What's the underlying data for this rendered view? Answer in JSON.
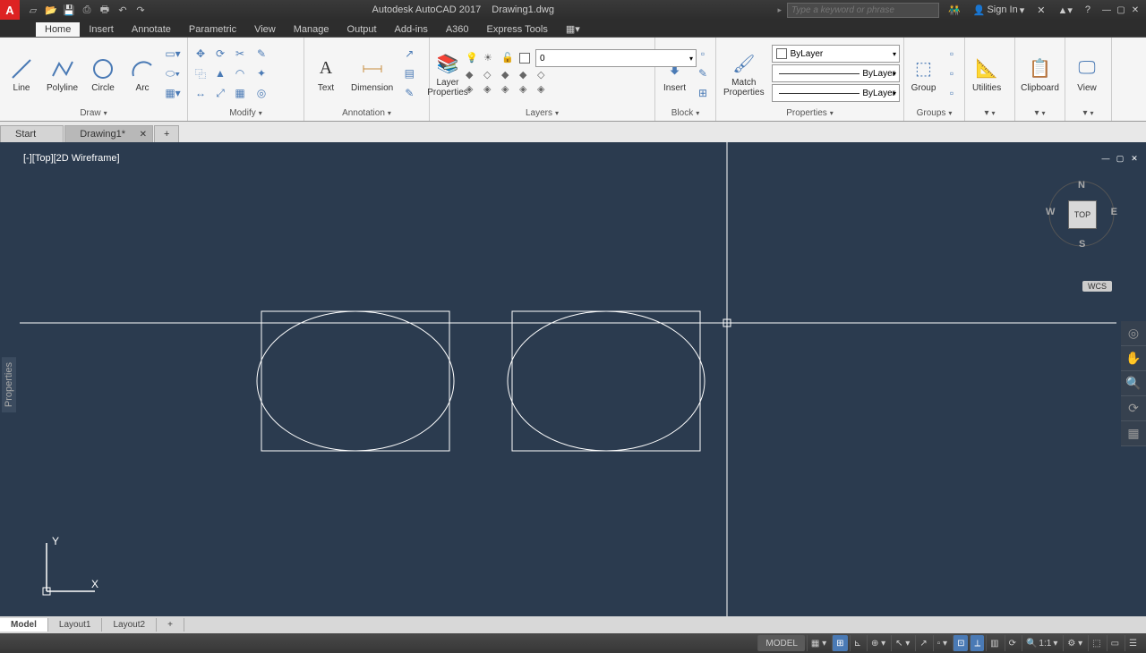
{
  "app": {
    "name": "Autodesk AutoCAD 2017",
    "file": "Drawing1.dwg",
    "search_placeholder": "Type a keyword or phrase",
    "sign_in": "Sign In"
  },
  "ribbon": {
    "tabs": [
      "Home",
      "Insert",
      "Annotate",
      "Parametric",
      "View",
      "Manage",
      "Output",
      "Add-ins",
      "A360",
      "Express Tools"
    ],
    "draw": {
      "line": "Line",
      "polyline": "Polyline",
      "circle": "Circle",
      "arc": "Arc",
      "title": "Draw"
    },
    "modify": {
      "title": "Modify"
    },
    "annotation": {
      "text": "Text",
      "dimension": "Dimension",
      "title": "Annotation"
    },
    "layers": {
      "properties": "Layer\nProperties",
      "current": "0",
      "title": "Layers"
    },
    "block": {
      "insert": "Insert",
      "title": "Block"
    },
    "properties": {
      "match": "Match\nProperties",
      "bylayer": "ByLayer",
      "title": "Properties"
    },
    "groups": {
      "group": "Group",
      "title": "Groups"
    },
    "utilities": {
      "title": "Utilities"
    },
    "clipboard": {
      "title": "Clipboard"
    },
    "view": {
      "title": "View"
    }
  },
  "file_tabs": {
    "start": "Start",
    "drawing": "Drawing1*"
  },
  "canvas": {
    "view_label": "[-][Top][2D Wireframe]",
    "viewcube": {
      "face": "TOP",
      "n": "N",
      "s": "S",
      "e": "E",
      "w": "W"
    },
    "wcs": "WCS",
    "ucs": {
      "x": "X",
      "y": "Y"
    }
  },
  "model_tabs": [
    "Model",
    "Layout1",
    "Layout2"
  ],
  "status": {
    "model": "MODEL",
    "scale": "1:1"
  }
}
